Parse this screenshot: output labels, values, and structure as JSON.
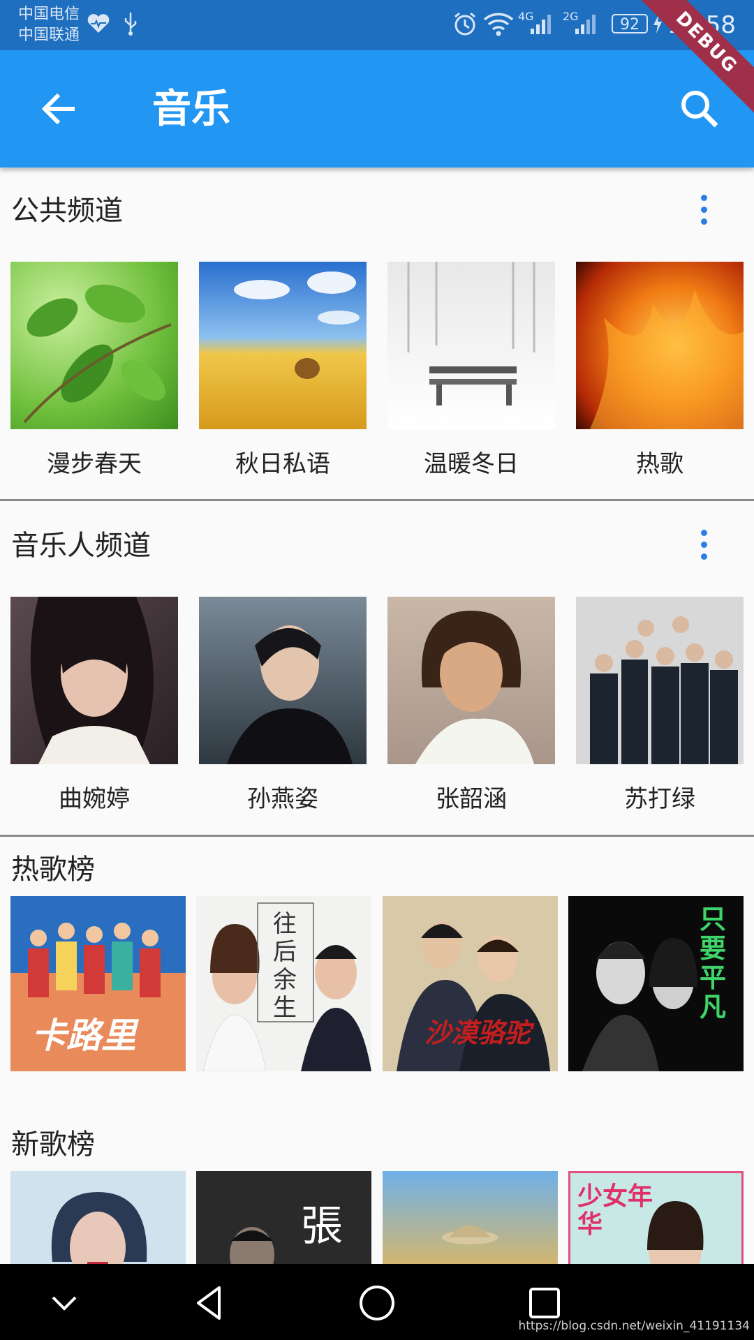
{
  "status_bar": {
    "carrier_1": "中国电信",
    "carrier_2": "中国联通",
    "net_1": "4G",
    "net_2": "2G",
    "battery": "92",
    "time": "16:58"
  },
  "app_bar": {
    "title": "音乐",
    "ribbon": "DEBUG"
  },
  "public_channel": {
    "title": "公共频道",
    "items": [
      {
        "label": "漫步春天"
      },
      {
        "label": "秋日私语"
      },
      {
        "label": "温暖冬日"
      },
      {
        "label": "热歌"
      }
    ]
  },
  "artist_channel": {
    "title": "音乐人频道",
    "items": [
      {
        "label": "曲婉婷"
      },
      {
        "label": "孙燕姿"
      },
      {
        "label": "张韶涵"
      },
      {
        "label": "苏打绿"
      }
    ]
  },
  "hot_chart": {
    "title": "热歌榜",
    "covers": [
      {
        "text": "卡路里"
      },
      {
        "text": "往后余生"
      },
      {
        "text": "沙漠骆驼"
      },
      {
        "text": "只要平凡"
      }
    ]
  },
  "new_chart": {
    "title": "新歌榜",
    "covers": [
      {
        "text": ""
      },
      {
        "text": "張"
      },
      {
        "text": ""
      },
      {
        "text": "少女年华"
      }
    ]
  },
  "watermark": "https://blog.csdn.net/weixin_41191134",
  "colors": {
    "app_bar": "#2196f3",
    "status_bar": "#1f6fc0",
    "accent": "#2a7fe6"
  }
}
